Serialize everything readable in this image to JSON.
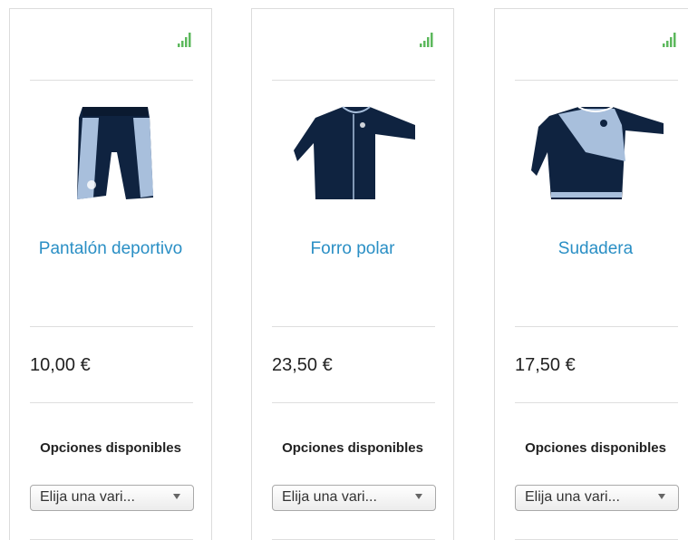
{
  "colors": {
    "link": "#2a8fc5",
    "stock_bars": "#5cb85c",
    "product_navy": "#0f2340",
    "product_lightblue": "#a8bfdc"
  },
  "products": [
    {
      "title": "Pantalón deportivo",
      "price": "10,00 €",
      "options_label": "Opciones disponibles",
      "select_value": "Elija una vari...",
      "stock_icon": "signal-bars-icon",
      "image_icon": "shorts-icon"
    },
    {
      "title": "Forro polar",
      "price": "23,50 €",
      "options_label": "Opciones disponibles",
      "select_value": "Elija una vari...",
      "stock_icon": "signal-bars-icon",
      "image_icon": "fleece-jacket-icon"
    },
    {
      "title": "Sudadera",
      "price": "17,50 €",
      "options_label": "Opciones disponibles",
      "select_value": "Elija una vari...",
      "stock_icon": "signal-bars-icon",
      "image_icon": "sweatshirt-icon"
    }
  ]
}
